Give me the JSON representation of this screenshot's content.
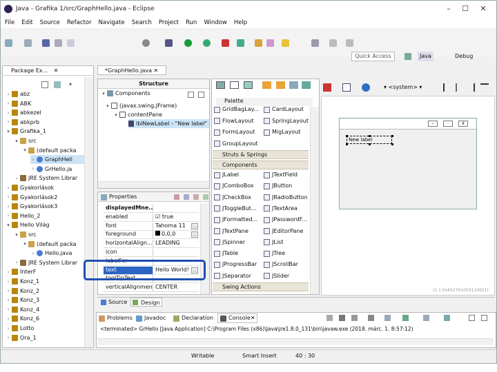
{
  "window": {
    "title": "Java - Grafika 1/src/GraphHello.java - Eclipse"
  },
  "menu": [
    "File",
    "Edit",
    "Source",
    "Refactor",
    "Navigate",
    "Search",
    "Project",
    "Run",
    "Window",
    "Help"
  ],
  "quick_access": "Quick Access",
  "perspectives": {
    "java": "Java",
    "debug": "Debug"
  },
  "package_explorer": {
    "tab": "Package Ex...",
    "items": [
      {
        "label": "abz",
        "type": "project",
        "indent": 0,
        "arrow": "right"
      },
      {
        "label": "ABK",
        "type": "project",
        "indent": 0,
        "arrow": "right"
      },
      {
        "label": "abkezel",
        "type": "project",
        "indent": 0,
        "arrow": "right"
      },
      {
        "label": "abkprb",
        "type": "project",
        "indent": 0,
        "arrow": "right"
      },
      {
        "label": "Grafika_1",
        "type": "project",
        "indent": 0,
        "arrow": "down"
      },
      {
        "label": "src",
        "type": "src",
        "indent": 1,
        "arrow": "down"
      },
      {
        "label": "(default packa",
        "type": "pkg",
        "indent": 2,
        "arrow": "down"
      },
      {
        "label": "GraphHell",
        "type": "java",
        "indent": 3,
        "arrow": "right",
        "selected": true
      },
      {
        "label": "GrHello.ja",
        "type": "java",
        "indent": 3,
        "arrow": "right"
      },
      {
        "label": "JRE System Librar",
        "type": "lib",
        "indent": 1,
        "arrow": "right"
      },
      {
        "label": "Gyakorlások",
        "type": "project",
        "indent": 0,
        "arrow": "right"
      },
      {
        "label": "Gyakorlások2",
        "type": "project",
        "indent": 0,
        "arrow": "right"
      },
      {
        "label": "Gyakorlások3",
        "type": "project",
        "indent": 0,
        "arrow": "right"
      },
      {
        "label": "Hello_2",
        "type": "project",
        "indent": 0,
        "arrow": "right"
      },
      {
        "label": "Hello Világ",
        "type": "project",
        "indent": 0,
        "arrow": "down"
      },
      {
        "label": "src",
        "type": "src",
        "indent": 1,
        "arrow": "down"
      },
      {
        "label": "(default packa",
        "type": "pkg",
        "indent": 2,
        "arrow": "down"
      },
      {
        "label": "Hello.java",
        "type": "java",
        "indent": 3,
        "arrow": "right"
      },
      {
        "label": "JRE System Librar",
        "type": "lib",
        "indent": 1,
        "arrow": "right"
      },
      {
        "label": "InterF",
        "type": "project",
        "indent": 0,
        "arrow": "right"
      },
      {
        "label": "Konz_1",
        "type": "project",
        "indent": 0,
        "arrow": "right"
      },
      {
        "label": "Konz_2",
        "type": "project",
        "indent": 0,
        "arrow": "right"
      },
      {
        "label": "Konz_3",
        "type": "project",
        "indent": 0,
        "arrow": "right"
      },
      {
        "label": "Konz_4",
        "type": "project",
        "indent": 0,
        "arrow": "right"
      },
      {
        "label": "Konz_6",
        "type": "project",
        "indent": 0,
        "arrow": "right"
      },
      {
        "label": "Lotto",
        "type": "project",
        "indent": 0,
        "arrow": "right"
      },
      {
        "label": "Ora_1",
        "type": "project",
        "indent": 0,
        "arrow": "right"
      }
    ]
  },
  "editor": {
    "tab": "*GraphHello.java"
  },
  "structure": {
    "header": "Structure",
    "components_label": "Components",
    "tree": [
      {
        "label": "(javax.swing.JFrame)",
        "indent": 1
      },
      {
        "label": "contentPane",
        "indent": 2
      },
      {
        "label": "lblNewLabel - \"New label\"",
        "indent": 3
      }
    ]
  },
  "properties": {
    "header": "Properties",
    "rows": [
      {
        "k": "displayedMne...",
        "v": "",
        "bold": true
      },
      {
        "k": "enabled",
        "v": "true",
        "check": true
      },
      {
        "k": "font",
        "v": "Tahoma 11"
      },
      {
        "k": "foreground",
        "v": "0,0,0",
        "swatch": true
      },
      {
        "k": "horizontalAlign...",
        "v": "LEADING"
      },
      {
        "k": "icon",
        "v": ""
      },
      {
        "k": "labelFor",
        "v": ""
      },
      {
        "k": "text",
        "v": "Hello World!",
        "selected": true
      },
      {
        "k": "toolTipText",
        "v": ""
      },
      {
        "k": "verticalAlignment",
        "v": "CENTER"
      }
    ]
  },
  "palette": {
    "header": "Palette",
    "rows_top": [
      [
        "GridBagLay...",
        "CardLayout"
      ],
      [
        "FlowLayout",
        "SpringLayout"
      ],
      [
        "FormLayout",
        "MigLayout"
      ],
      [
        "GroupLayout",
        ""
      ]
    ],
    "sections": [
      "Struts & Springs",
      "Components",
      "Swing Actions"
    ],
    "components": [
      [
        "JLabel",
        "JTextField"
      ],
      [
        "JComboBox",
        "JButton"
      ],
      [
        "JCheckBox",
        "JRadioButton"
      ],
      [
        "JToggleBut...",
        "JTextArea"
      ],
      [
        "JFormatted...",
        "JPasswordF..."
      ],
      [
        "JTextPane",
        "JEditorPane"
      ],
      [
        "JSpinner",
        "JList"
      ],
      [
        "JTable",
        "JTree"
      ],
      [
        "JProgressBar",
        "JScrollBar"
      ],
      [
        "JSeparator",
        "JSlider"
      ]
    ]
  },
  "design_toolbar": {
    "system": "<system>"
  },
  "canvas": {
    "label": "New label",
    "coords": "(1.1.0x452761050110621)"
  },
  "bottom_tabs": {
    "source": "Source",
    "design": "Design"
  },
  "console": {
    "tabs": [
      "Problems",
      "Javadoc",
      "Declaration",
      "Console"
    ],
    "text": "<terminated> GrHello [Java Application] C:\\Program Files (x86)\\Java\\jre1.8.0_131\\bin\\javaw.exe (2018. márc. 1. 8:57:12)"
  },
  "status": {
    "writable": "Writable",
    "insert": "Smart Insert",
    "pos": "40 : 30"
  },
  "colors": {
    "selection": "#cce4f7",
    "highlight": "#1f4fb0",
    "palette_header": "#e8e4d8"
  }
}
